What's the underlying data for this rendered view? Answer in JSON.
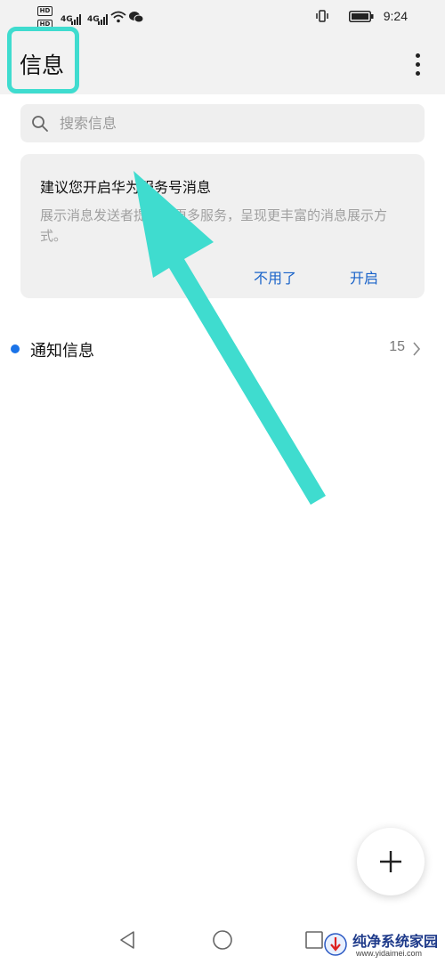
{
  "status_bar": {
    "left_badges": [
      "HD",
      "HD"
    ],
    "network_labels": [
      "4G",
      "4G"
    ],
    "time": "9:24"
  },
  "header": {
    "title": "信息",
    "menu_icon": "more-vertical-icon"
  },
  "search": {
    "placeholder": "搜索信息",
    "icon": "search-icon"
  },
  "suggestion_card": {
    "title": "建议您开启华为服务号消息",
    "description": "展示消息发送者提供的更多服务，呈现更丰富的消息展示方式。",
    "dismiss_label": "不用了",
    "enable_label": "开启"
  },
  "conversations": [
    {
      "label": "通知信息",
      "count": "15",
      "unread": true
    }
  ],
  "fab": {
    "icon": "plus-icon"
  },
  "nav_bar": {
    "icons": [
      "back-triangle-icon",
      "home-circle-icon",
      "recents-square-icon"
    ]
  },
  "watermark": {
    "text": "纯净系统家园",
    "url": "www.yidaimei.com"
  },
  "colors": {
    "highlight": "#3fdccf",
    "accent": "#1a63c9",
    "unread_dot": "#1a73e8",
    "card_background": "#f0f0f0"
  }
}
